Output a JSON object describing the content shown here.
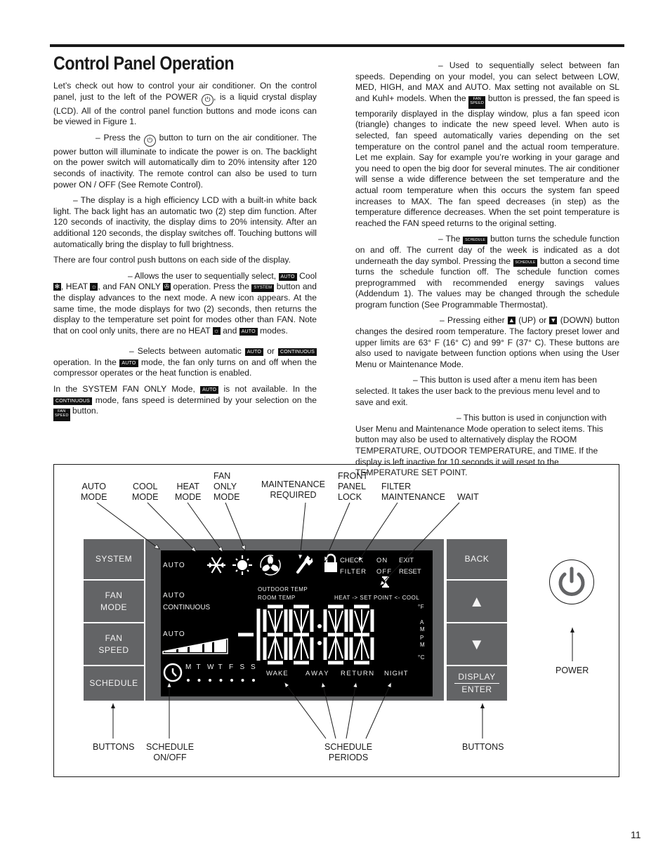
{
  "page": {
    "title": "Control Panel Operation",
    "page_number": "11"
  },
  "left_column": {
    "intro": {
      "before_icon": "Let’s check out how to control your air conditioner.  On the control panel, just to the left of the POWER ",
      "icon": "power-icon",
      "after_icon": ", is a liquid crystal display (LCD).  All of the control panel function buttons and mode icons can be viewed in Figure 1."
    },
    "power": {
      "before_icon": "– Press the ",
      "icon": "power-icon",
      "after_icon": " button to turn on the air conditioner. The power button will illuminate to indicate the power is on. The backlight on the power switch will automatically dim to 20% intensity after 120 seconds of inactivity. The remote control can also be used to turn power ON / OFF (See Remote Control)."
    },
    "display": "–  The display is a high efficiency LCD with a built-in white back light.  The back light has an automatic two (2) step dim function. After 120 seconds of inactivity, the display dims to 20% intensity.  After an additional 120 seconds, the display switches off.  Touching buttons will automatically bring the display to full brightness.",
    "four_buttons": "There are four control push buttons on each side of the display.",
    "system": {
      "p1": "– Allows the user to sequentially select, ",
      "chip_auto": "AUTO",
      "p2": " Cool ",
      "p3": ", HEAT ",
      "p4": ", and FAN ONLY ",
      "p5": " operation.  Press the ",
      "chip_system": "SYSTEM",
      "p6": " button and the display advances to the next mode.  A new icon appears.  At the same time, the mode displays for two (2) seconds, then returns the display to the temperature set point for modes other than FAN.  Note that on cool only units, there are no HEAT ",
      "p7": " and ",
      "p8": " modes."
    },
    "fan_mode": {
      "p1": "– Selects between automatic ",
      "chip_auto": "AUTO",
      "p2": " or ",
      "chip_continuous": "CONTINUOUS",
      "p3": " operation.  In the ",
      "p4": " mode, the fan only turns on and off when the compressor operates or the heat function is enabled."
    },
    "fan_only_note": {
      "p1": "In the SYSTEM FAN ONLY Mode, ",
      "p2": " is not available. In the ",
      "p3": " mode, fans speed is determined by your selection on the ",
      "chip_fan_speed_1": "FAN",
      "chip_fan_speed_2": "SPEED",
      "p4": " button."
    }
  },
  "right_column": {
    "fan_speed": {
      "p1": "– Used to sequentially select between fan speeds. Depending on your model, you can select between LOW, MED, HIGH, and MAX and AUTO.  Max setting not available on SL and Kuhl+ models. When the ",
      "p2": " button is pressed, the fan speed is temporarily displayed in the display window, plus a fan speed icon (triangle) changes to indicate the new speed level. When auto is selected, fan speed automatically varies depending on the set temperature on the control panel and the actual room temperature.  Let me explain.  Say for example you’re working in your garage and you need to open the big door for several minutes.  The air conditioner will sense a wide difference between the set temperature and the actual room temperature when this occurs the system fan speed increases to MAX.  The fan speed decreases (in step) as the temperature difference decreases.  When the set point temperature is reached the FAN speed returns to the original setting."
    },
    "schedule": {
      "p1": "– The ",
      "chip_schedule": "SCHEDULE",
      "p2": " button turns the schedule function on and off.  The current day of the week is indicated as a dot underneath the day symbol.  Pressing the ",
      "p3": " button a second time turns the schedule function off.  The schedule function comes preprogrammed with recommended energy savings values (Addendum 1).  The values may be changed through the schedule program function (See Programmable Thermostat)."
    },
    "updown": {
      "p1": "– Pressing either ",
      "p2": " (UP) or ",
      "p3": " (DOWN) button changes the desired room temperature.  The factory preset lower and upper limits are 63° F (16° C) and 99° F (37° C).  These buttons are also used to navigate between function options when using the User Menu or Maintenance Mode."
    },
    "back": "– This button is used after a menu item has been selected. It takes the user back to the previous menu level and to save and exit.",
    "display_enter": "– This button is used in conjunction with User Menu and Maintenance Mode operation to select items. This button may also be used to alternatively display the ROOM TEMPERATURE, OUTDOOR TEMPERATURE, and TIME. If the display is left inactive for 10 seconds it will reset to the TEMPERATURE SET POINT."
  },
  "figure": {
    "callouts_top": {
      "auto_mode": [
        "AUTO",
        "MODE"
      ],
      "cool_mode": [
        "COOL",
        "MODE"
      ],
      "heat_mode": [
        "HEAT",
        "MODE"
      ],
      "fan_only_mode": [
        "FAN",
        "ONLY",
        "MODE"
      ],
      "maintenance_required": [
        "MAINTENANCE",
        "REQUIRED"
      ],
      "front_panel_lock": [
        "FRONT",
        "PANEL",
        "LOCK"
      ],
      "filter_maintenance": [
        "FILTER",
        "MAINTENANCE"
      ],
      "wait": [
        "WAIT"
      ]
    },
    "callouts_bottom": {
      "buttons_left": [
        "BUTTONS"
      ],
      "schedule_on_off": [
        "SCHEDULE",
        "ON/OFF"
      ],
      "schedule_periods": [
        "SCHEDULE",
        "PERIODS"
      ],
      "buttons_right": [
        "BUTTONS"
      ],
      "power": [
        "POWER"
      ]
    },
    "left_buttons": [
      {
        "label": "SYSTEM"
      },
      {
        "label": "FAN\nMODE",
        "l1": "FAN",
        "l2": "MODE"
      },
      {
        "label": "FAN\nSPEED",
        "l1": "FAN",
        "l2": "SPEED"
      },
      {
        "label": "SCHEDULE"
      }
    ],
    "right_buttons": [
      {
        "label": "BACK"
      },
      {
        "label": "UP",
        "icon": "triangle-up-icon"
      },
      {
        "label": "DOWN",
        "icon": "triangle-down-icon"
      },
      {
        "label": "DISPLAY/ENTER",
        "l1": "DISPLAY",
        "l2": "ENTER"
      }
    ],
    "lcd": {
      "mode_auto": "AUTO",
      "fan_auto": "AUTO",
      "fan_continuous": "CONTINUOUS",
      "speed_auto": "AUTO",
      "outdoor_temp": "OUTDOOR   TEMP",
      "room_temp": "ROOM  TEMP",
      "check": "CHECK",
      "filter": "FILTER",
      "on": "ON",
      "off": "OFF",
      "exit": "EXIT",
      "reset": "RESET",
      "setpoint": "HEAT -> SET POINT   <- COOL",
      "unit_f": "°F",
      "unit_c": "°C",
      "am": [
        "A",
        "M"
      ],
      "pm": [
        "P",
        "M"
      ],
      "days": [
        "M",
        "T",
        "W",
        "T",
        "F",
        "S",
        "S"
      ],
      "periods": [
        "WAKE",
        "AWAY",
        "RETURN",
        "NIGHT"
      ],
      "digits": "-188:88",
      "icons": [
        "snowflake-icon",
        "sun-icon",
        "fan-icon",
        "wrench-icon",
        "padlock-icon",
        "hourglass-icon",
        "clock-icon",
        "fan-speed-bars-icon"
      ]
    }
  }
}
